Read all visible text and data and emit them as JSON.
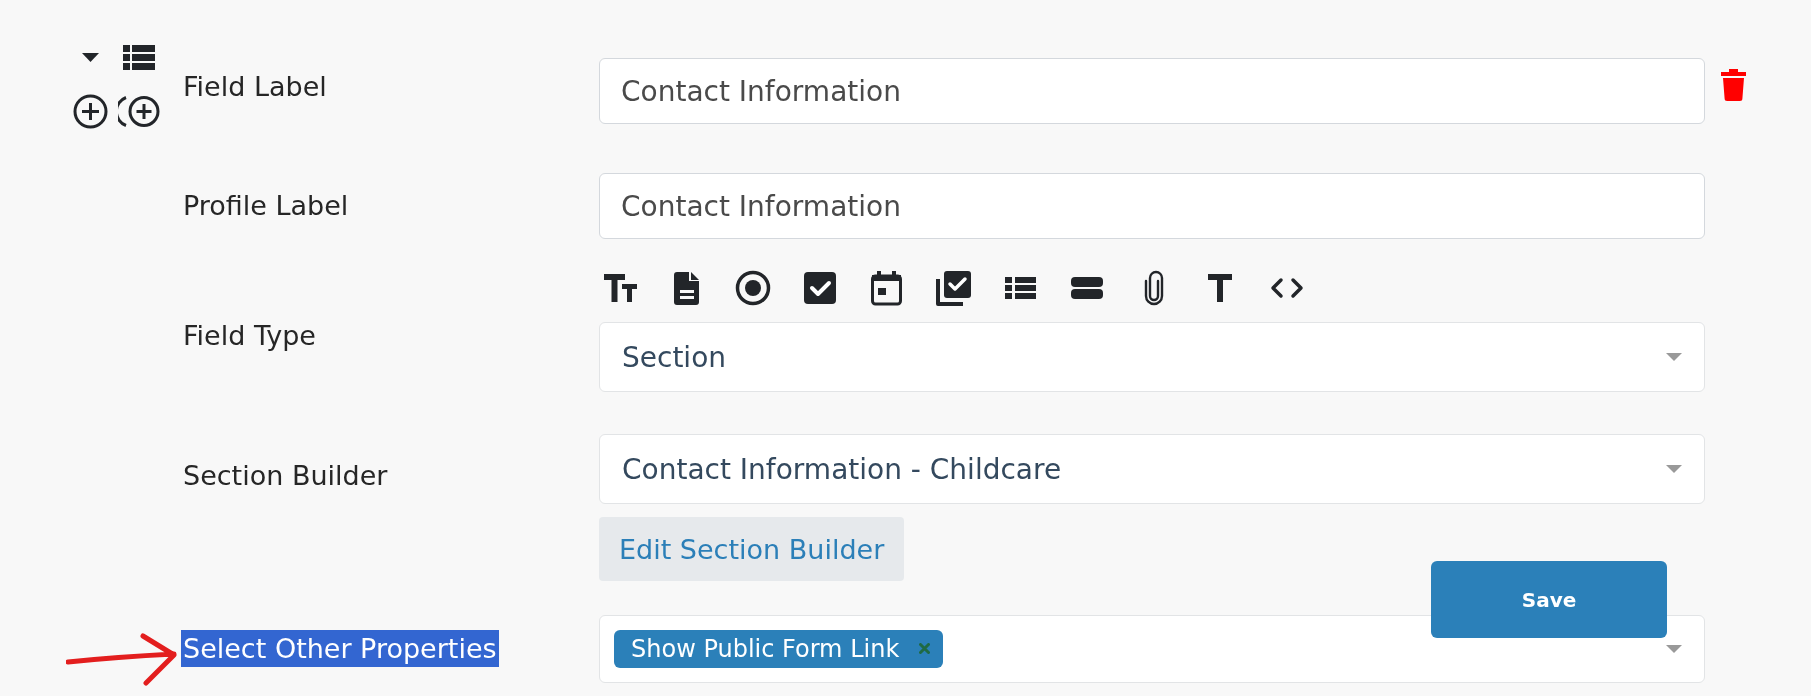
{
  "fields": [
    {
      "kind": "input",
      "label": "Field Label",
      "value": "Contact Information",
      "highlighted": false,
      "annotated": false
    },
    {
      "kind": "input",
      "label": "Profile Label",
      "value": "Contact Information",
      "highlighted": false,
      "annotated": false
    },
    {
      "kind": "type-select",
      "label": "Field Type",
      "value": "Section",
      "highlighted": false,
      "annotated": false
    },
    {
      "kind": "select",
      "label": "Section Builder",
      "value": "Contact Information - Childcare",
      "button": "Edit Section Builder",
      "highlighted": false,
      "annotated": false
    },
    {
      "kind": "multiselect",
      "label": "Select Other Properties",
      "tags": [
        {
          "label": "Show Public Form Link"
        }
      ],
      "highlighted": true,
      "annotated": true
    }
  ],
  "save_button": {
    "label": "Save"
  }
}
